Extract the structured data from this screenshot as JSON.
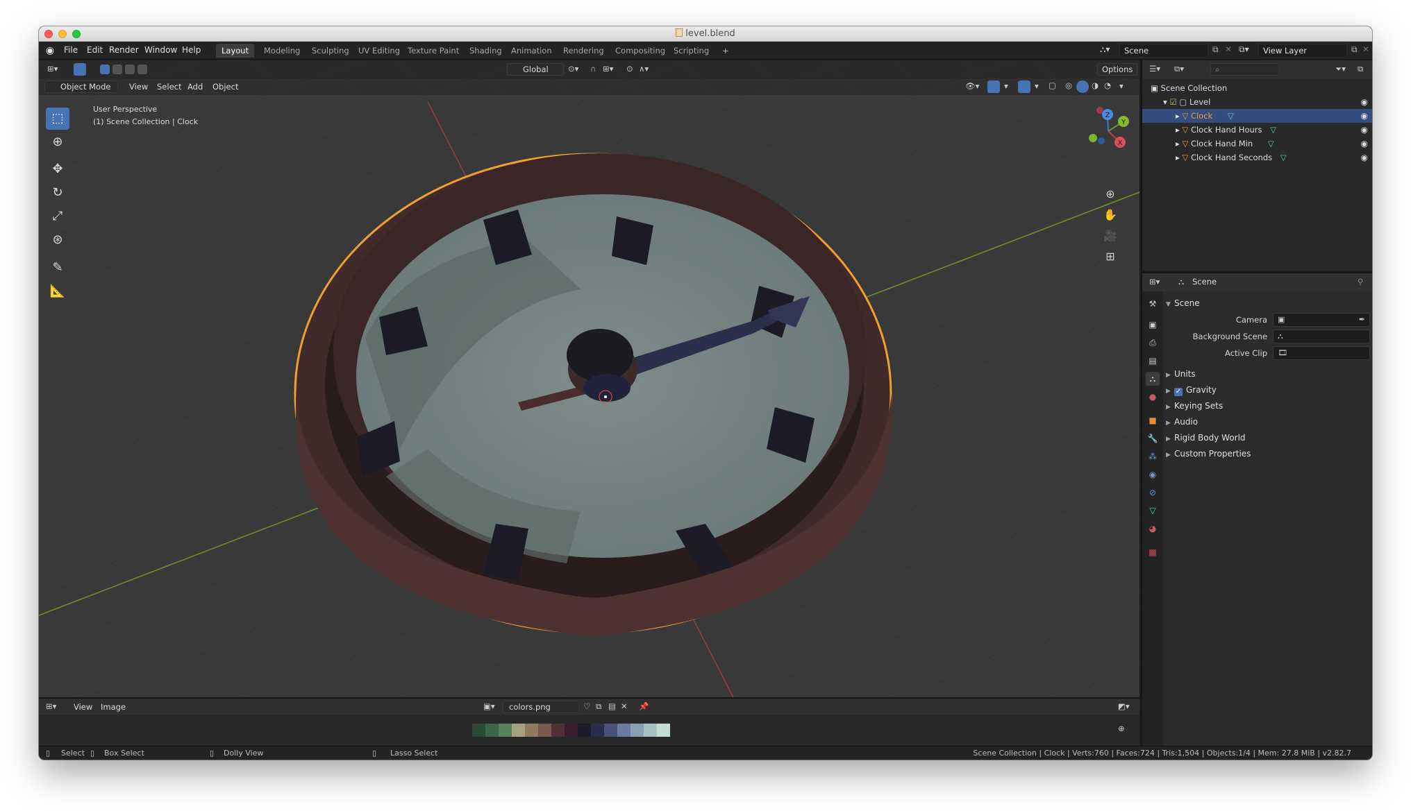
{
  "window": {
    "title": "level.blend"
  },
  "menubar": {
    "items": [
      "File",
      "Edit",
      "Render",
      "Window",
      "Help"
    ],
    "workspaces": [
      "Layout",
      "Modeling",
      "Sculpting",
      "UV Editing",
      "Texture Paint",
      "Shading",
      "Animation",
      "Rendering",
      "Compositing",
      "Scripting"
    ],
    "active_workspace": "Layout",
    "add_tab": "+",
    "scene_name": "Scene",
    "view_layer": "View Layer"
  },
  "viewport": {
    "transform_orientation": "Global",
    "options_label": "Options",
    "mode": "Object Mode",
    "menus": [
      "View",
      "Select",
      "Add",
      "Object"
    ],
    "overlay_line1": "User Perspective",
    "overlay_line2": "(1) Scene Collection | Clock",
    "gizmo_axes": {
      "x": "X",
      "y": "Y",
      "z": "Z"
    }
  },
  "outliner": {
    "root": "Scene Collection",
    "collection": "Level",
    "objects": [
      {
        "name": "Clock",
        "selected": true
      },
      {
        "name": "Clock Hand Hours",
        "selected": false
      },
      {
        "name": "Clock Hand Min",
        "selected": false
      },
      {
        "name": "Clock Hand Seconds",
        "selected": false
      }
    ]
  },
  "properties": {
    "context": "Scene",
    "panel_title": "Scene",
    "fields": [
      {
        "label": "Camera"
      },
      {
        "label": "Background Scene"
      },
      {
        "label": "Active Clip"
      }
    ],
    "subpanels": [
      "Units",
      "Gravity",
      "Keying Sets",
      "Audio",
      "Rigid Body World",
      "Custom Properties"
    ],
    "gravity_checked": true
  },
  "image_editor": {
    "menus": [
      "View",
      "Image"
    ],
    "image_name": "colors.png",
    "palette": [
      "#2c4a35",
      "#3c6648",
      "#5a8060",
      "#a7a27e",
      "#8c7a62",
      "#7a5a4e",
      "#4e3236",
      "#3a1e2e",
      "#1e1a2a",
      "#2a2c4c",
      "#4a5278",
      "#6a7aa2",
      "#8aa0b4",
      "#a8c0c0",
      "#c6dcd2"
    ]
  },
  "statusbar": {
    "select": "Select",
    "box_select": "Box Select",
    "dolly_view": "Dolly View",
    "lasso_select": "Lasso Select",
    "stats": "Scene Collection | Clock | Verts:760 | Faces:724 | Tris:1,504 | Objects:1/4 | Mem: 27.8 MiB | v2.82.7"
  },
  "colors": {
    "selection_blue": "#4772b3",
    "outline_orange": "#f0a030",
    "clock_rim": "#4a2f2e",
    "clock_face": "#6f7f7c",
    "markers": "#1b1b24"
  }
}
